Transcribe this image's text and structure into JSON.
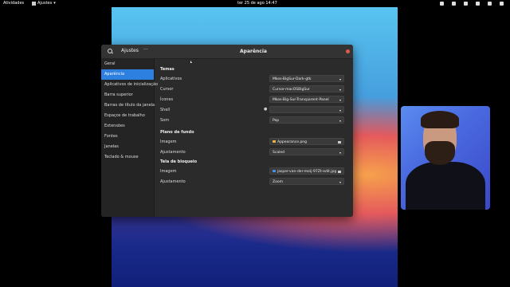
{
  "topbar": {
    "activities": "Atividades",
    "app_name": "Ajustes",
    "clock": "ter 25 de ago  14:47"
  },
  "window": {
    "app_title": "Ajustes",
    "page_title": "Aparência"
  },
  "sidebar": {
    "items": [
      {
        "label": "Geral"
      },
      {
        "label": "Aparência"
      },
      {
        "label": "Aplicativos de inicialização"
      },
      {
        "label": "Barra superior"
      },
      {
        "label": "Barras de título da janela"
      },
      {
        "label": "Espaços de trabalho"
      },
      {
        "label": "Extensões"
      },
      {
        "label": "Fontes"
      },
      {
        "label": "Janelas"
      },
      {
        "label": "Teclado & mouse"
      }
    ]
  },
  "temas": {
    "title": "Temas",
    "aplicativos": {
      "label": "Aplicativos",
      "value": "Mkos-BigSur-Dark-gtk"
    },
    "cursor": {
      "label": "Cursor",
      "value": "Cursor-macOSBigSur"
    },
    "icones": {
      "label": "Ícones",
      "value": "Mkos-Big-Sur-Transparent-Panel"
    },
    "shell": {
      "label": "Shell",
      "value": ""
    },
    "som": {
      "label": "Som",
      "value": "Pop"
    }
  },
  "fundo": {
    "title": "Plano de fundo",
    "imagem": {
      "label": "Imagem",
      "value": "Appearance.png"
    },
    "ajustamento": {
      "label": "Ajustamento",
      "value": "Scaled"
    }
  },
  "bloqueio": {
    "title": "Tela de bloqueio",
    "imagem": {
      "label": "Imagem",
      "value": "jasper-van-der-meij-97Zt-edit.jpg"
    },
    "ajustamento": {
      "label": "Ajustamento",
      "value": "Zoom"
    }
  }
}
